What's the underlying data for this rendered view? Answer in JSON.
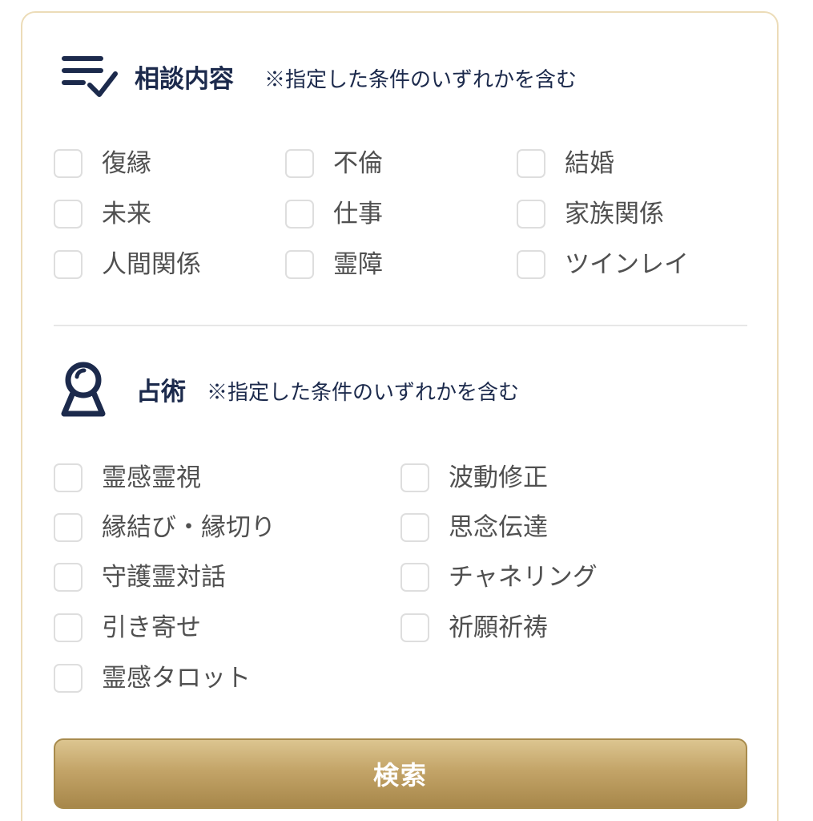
{
  "consultation": {
    "icon": "checklist-icon",
    "title": "相談内容",
    "note": "※指定した条件のいずれかを含む",
    "options": [
      {
        "label": "復縁",
        "checked": false
      },
      {
        "label": "不倫",
        "checked": false
      },
      {
        "label": "結婚",
        "checked": false
      },
      {
        "label": "未来",
        "checked": false
      },
      {
        "label": "仕事",
        "checked": false
      },
      {
        "label": "家族関係",
        "checked": false
      },
      {
        "label": "人間関係",
        "checked": false
      },
      {
        "label": "霊障",
        "checked": false
      },
      {
        "label": "ツインレイ",
        "checked": false
      }
    ]
  },
  "divination": {
    "icon": "crystal-ball-icon",
    "title": "占術",
    "note": "※指定した条件のいずれかを含む",
    "options": [
      {
        "label": "霊感霊視",
        "checked": false
      },
      {
        "label": "波動修正",
        "checked": false
      },
      {
        "label": "縁結び・縁切り",
        "checked": false
      },
      {
        "label": "思念伝達",
        "checked": false
      },
      {
        "label": "守護霊対話",
        "checked": false
      },
      {
        "label": "チャネリング",
        "checked": false
      },
      {
        "label": "引き寄せ",
        "checked": false
      },
      {
        "label": "祈願祈祷",
        "checked": false
      },
      {
        "label": "霊感タロット",
        "checked": false
      }
    ]
  },
  "search_button": {
    "label": "検索"
  },
  "colors": {
    "title_navy": "#1c2a4c",
    "panel_border": "#ecdcb8",
    "button_gold": "#c3a468",
    "checkbox_border": "#dedede"
  }
}
